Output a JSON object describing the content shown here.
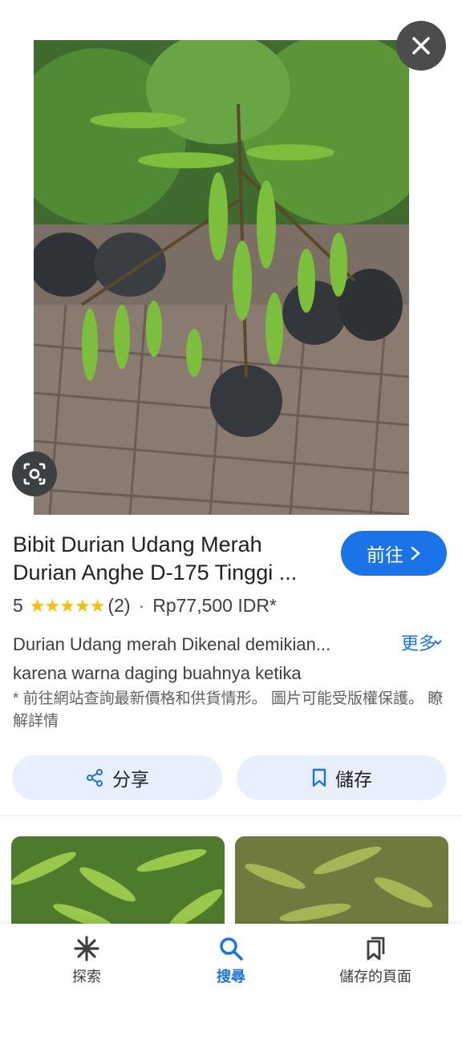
{
  "product": {
    "title_line1": "Bibit Durian Udang Merah",
    "title_line2": "Durian Anghe D-175 Tinggi ...",
    "visit_label": "前往",
    "rating_value": "5",
    "stars": "★★★★★",
    "review_count": "(2)",
    "separator": "·",
    "price": "Rp77,500 IDR*",
    "description_line1": "Durian Udang merah Dikenal demikian...",
    "description_line2": "karena warna daging buahnya ketika",
    "more_label": "更多",
    "note": "* 前往網站查詢最新價格和供貨情形。 圖片可能受版權保護。 瞭解詳情"
  },
  "actions": {
    "share_label": "分享",
    "save_label": "儲存"
  },
  "bottom_nav": {
    "items": [
      {
        "label": "探索",
        "icon": "asterisk-icon"
      },
      {
        "label": "搜尋",
        "icon": "search-icon",
        "active": true
      },
      {
        "label": "儲存的頁面",
        "icon": "saved-pages-icon"
      }
    ]
  },
  "colors": {
    "accent": "#1a73e8",
    "action_button_bg": "#e8f0fe",
    "star": "#fbbc04"
  }
}
